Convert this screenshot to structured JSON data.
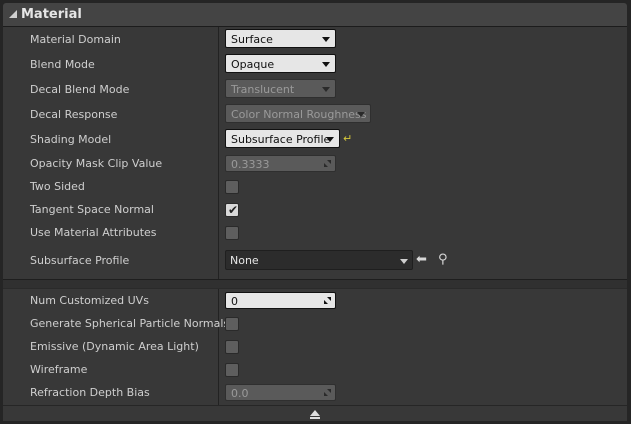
{
  "section": {
    "title": "Material"
  },
  "rows": {
    "material_domain": {
      "label": "Material Domain",
      "value": "Surface"
    },
    "blend_mode": {
      "label": "Blend Mode",
      "value": "Opaque"
    },
    "decal_blend_mode": {
      "label": "Decal Blend Mode",
      "value": "Translucent"
    },
    "decal_response": {
      "label": "Decal Response",
      "value": "Color Normal Roughness"
    },
    "shading_model": {
      "label": "Shading Model",
      "value": "Subsurface Profile"
    },
    "opacity_mask_clip": {
      "label": "Opacity Mask Clip Value",
      "value": "0.3333"
    },
    "two_sided": {
      "label": "Two Sided",
      "checked": false
    },
    "tangent_space_normal": {
      "label": "Tangent Space Normal",
      "checked": true
    },
    "use_material_attributes": {
      "label": "Use Material Attributes",
      "checked": false
    },
    "subsurface_profile": {
      "label": "Subsurface Profile",
      "value": "None"
    }
  },
  "advanced": {
    "num_customized_uvs": {
      "label": "Num Customized UVs",
      "value": "0"
    },
    "spherical_particle_normals": {
      "label": "Generate Spherical Particle Normals",
      "checked": false
    },
    "emissive_dynamic_area_light": {
      "label": "Emissive (Dynamic Area Light)",
      "checked": false
    },
    "wireframe": {
      "label": "Wireframe",
      "checked": false
    },
    "refraction_depth_bias": {
      "label": "Refraction Depth Bias",
      "value": "0.0"
    }
  },
  "colors": {
    "panel_bg": "#383838",
    "header_bg": "#444444",
    "reset_icon": "#d6c83a"
  },
  "icons": {
    "collapse": "triangle-down-icon",
    "reset": "reset-to-default-icon",
    "use_selected": "arrow-left-icon",
    "browse": "magnifier-icon",
    "expand_advanced": "chevron-up-icon"
  }
}
